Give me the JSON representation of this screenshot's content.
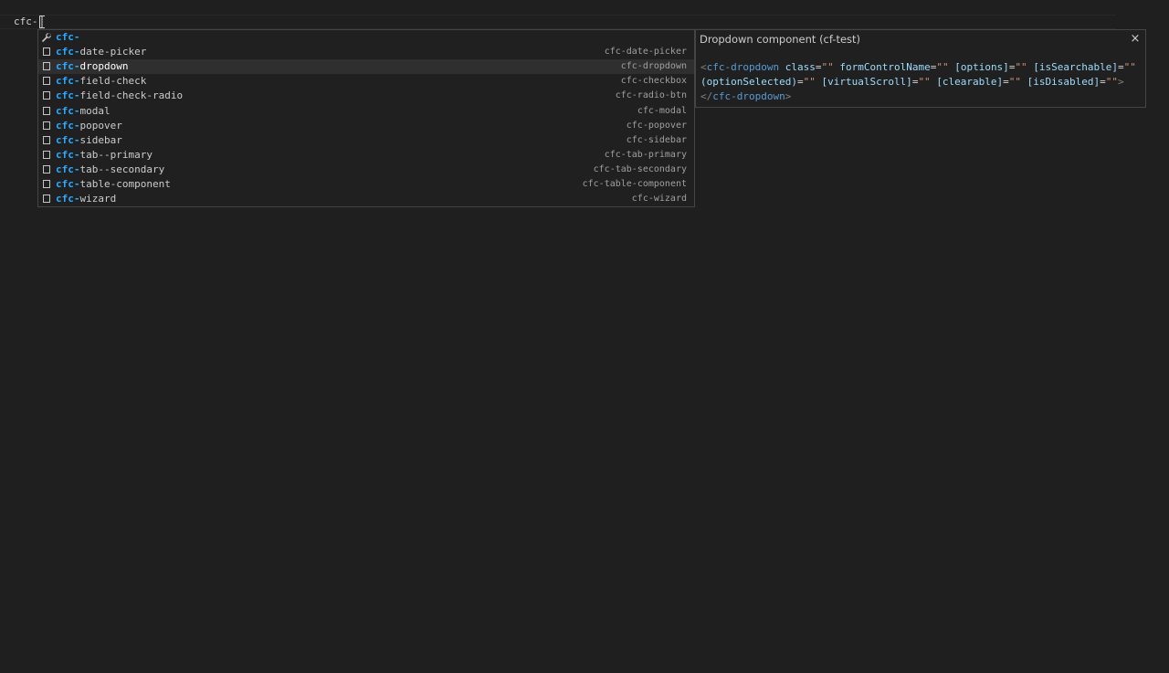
{
  "editor": {
    "typed_text": "cfc-"
  },
  "suggest": {
    "prefix": "cfc-",
    "items": [
      {
        "match": "cfc-",
        "rest": "",
        "detail": "",
        "icon": "wrench-icon"
      },
      {
        "match": "cfc-",
        "rest": "date-picker",
        "detail": "cfc-date-picker",
        "icon": "snippet-icon"
      },
      {
        "match": "cfc-",
        "rest": "dropdown",
        "detail": "cfc-dropdown",
        "icon": "snippet-icon",
        "selected": true
      },
      {
        "match": "cfc-",
        "rest": "field-check",
        "detail": "cfc-checkbox",
        "icon": "snippet-icon"
      },
      {
        "match": "cfc-",
        "rest": "field-check-radio",
        "detail": "cfc-radio-btn",
        "icon": "snippet-icon"
      },
      {
        "match": "cfc-",
        "rest": "modal",
        "detail": "cfc-modal",
        "icon": "snippet-icon"
      },
      {
        "match": "cfc-",
        "rest": "popover",
        "detail": "cfc-popover",
        "icon": "snippet-icon"
      },
      {
        "match": "cfc-",
        "rest": "sidebar",
        "detail": "cfc-sidebar",
        "icon": "snippet-icon"
      },
      {
        "match": "cfc-",
        "rest": "tab--primary",
        "detail": "cfc-tab-primary",
        "icon": "snippet-icon"
      },
      {
        "match": "cfc-",
        "rest": "tab--secondary",
        "detail": "cfc-tab-secondary",
        "icon": "snippet-icon"
      },
      {
        "match": "cfc-",
        "rest": "table-component",
        "detail": "cfc-table-component",
        "icon": "snippet-icon"
      },
      {
        "match": "cfc-",
        "rest": "wizard",
        "detail": "cfc-wizard",
        "icon": "snippet-icon"
      }
    ]
  },
  "details": {
    "title": "Dropdown component (cf-test)",
    "close_label": "×",
    "snippet": {
      "open_lt": "<",
      "tag": "cfc-dropdown",
      "attrs_line1": [
        {
          "name": "class",
          "value": "\"\""
        },
        {
          "name": "formControlName",
          "value": "\"\""
        },
        {
          "name": "[options]",
          "value": "\"\""
        },
        {
          "name": "[isSearchable]",
          "value": "\"\""
        }
      ],
      "attrs_line2": [
        {
          "name": "(optionSelected)",
          "value": "\"\""
        },
        {
          "name": "[virtualScroll]",
          "value": "\"\""
        },
        {
          "name": "[clearable]",
          "value": "\"\""
        },
        {
          "name": "[isDisabled]",
          "value": "\"\""
        }
      ],
      "open_gt": ">",
      "close_open": "</",
      "close_tag": "cfc-dropdown",
      "close_gt": ">"
    }
  },
  "colors": {
    "match": "#2aaaff",
    "tag": "#569cd6",
    "attr": "#9cdcfe",
    "string": "#ce9178",
    "punct": "#808080"
  }
}
